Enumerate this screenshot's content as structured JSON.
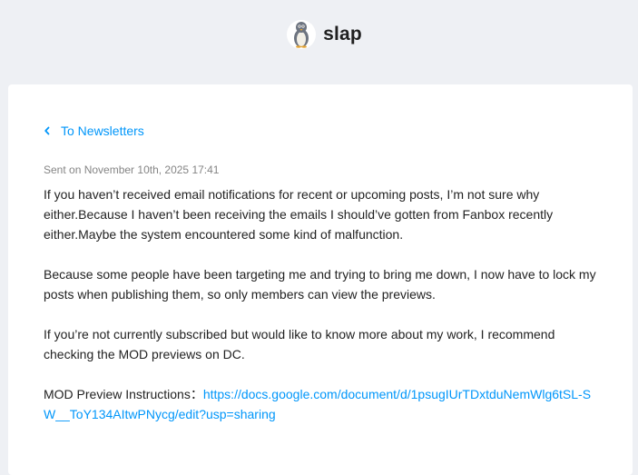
{
  "header": {
    "creator_name": "slap",
    "avatar_icon": "penguin-avatar-icon"
  },
  "post": {
    "back_label": "To Newsletters",
    "sent_label": "Sent on November 10th, 2025 17:41",
    "paragraphs": [
      "If you haven’t received email notifications for recent or upcoming posts, I’m not sure why either.Because I haven’t been receiving the emails I should’ve gotten from Fanbox recently either.Maybe the system encountered some kind of malfunction.",
      "Because some people have been targeting me and trying to bring me down, I now have to lock my posts when publishing them, so only members can view the previews.",
      "If you’re not currently subscribed but would like to know more about my work, I recommend checking the MOD previews on DC."
    ],
    "instructions_label": "MOD Preview Instructions：",
    "instructions_link": "https://docs.google.com/document/d/1psugIUrTDxtduNemWlg6tSL-SW__ToY134AItwPNycg/edit?usp=sharing"
  },
  "colors": {
    "page_bg": "#eef0f4",
    "card_bg": "#ffffff",
    "link": "#0096fa",
    "text": "#222222",
    "muted": "#858585"
  }
}
